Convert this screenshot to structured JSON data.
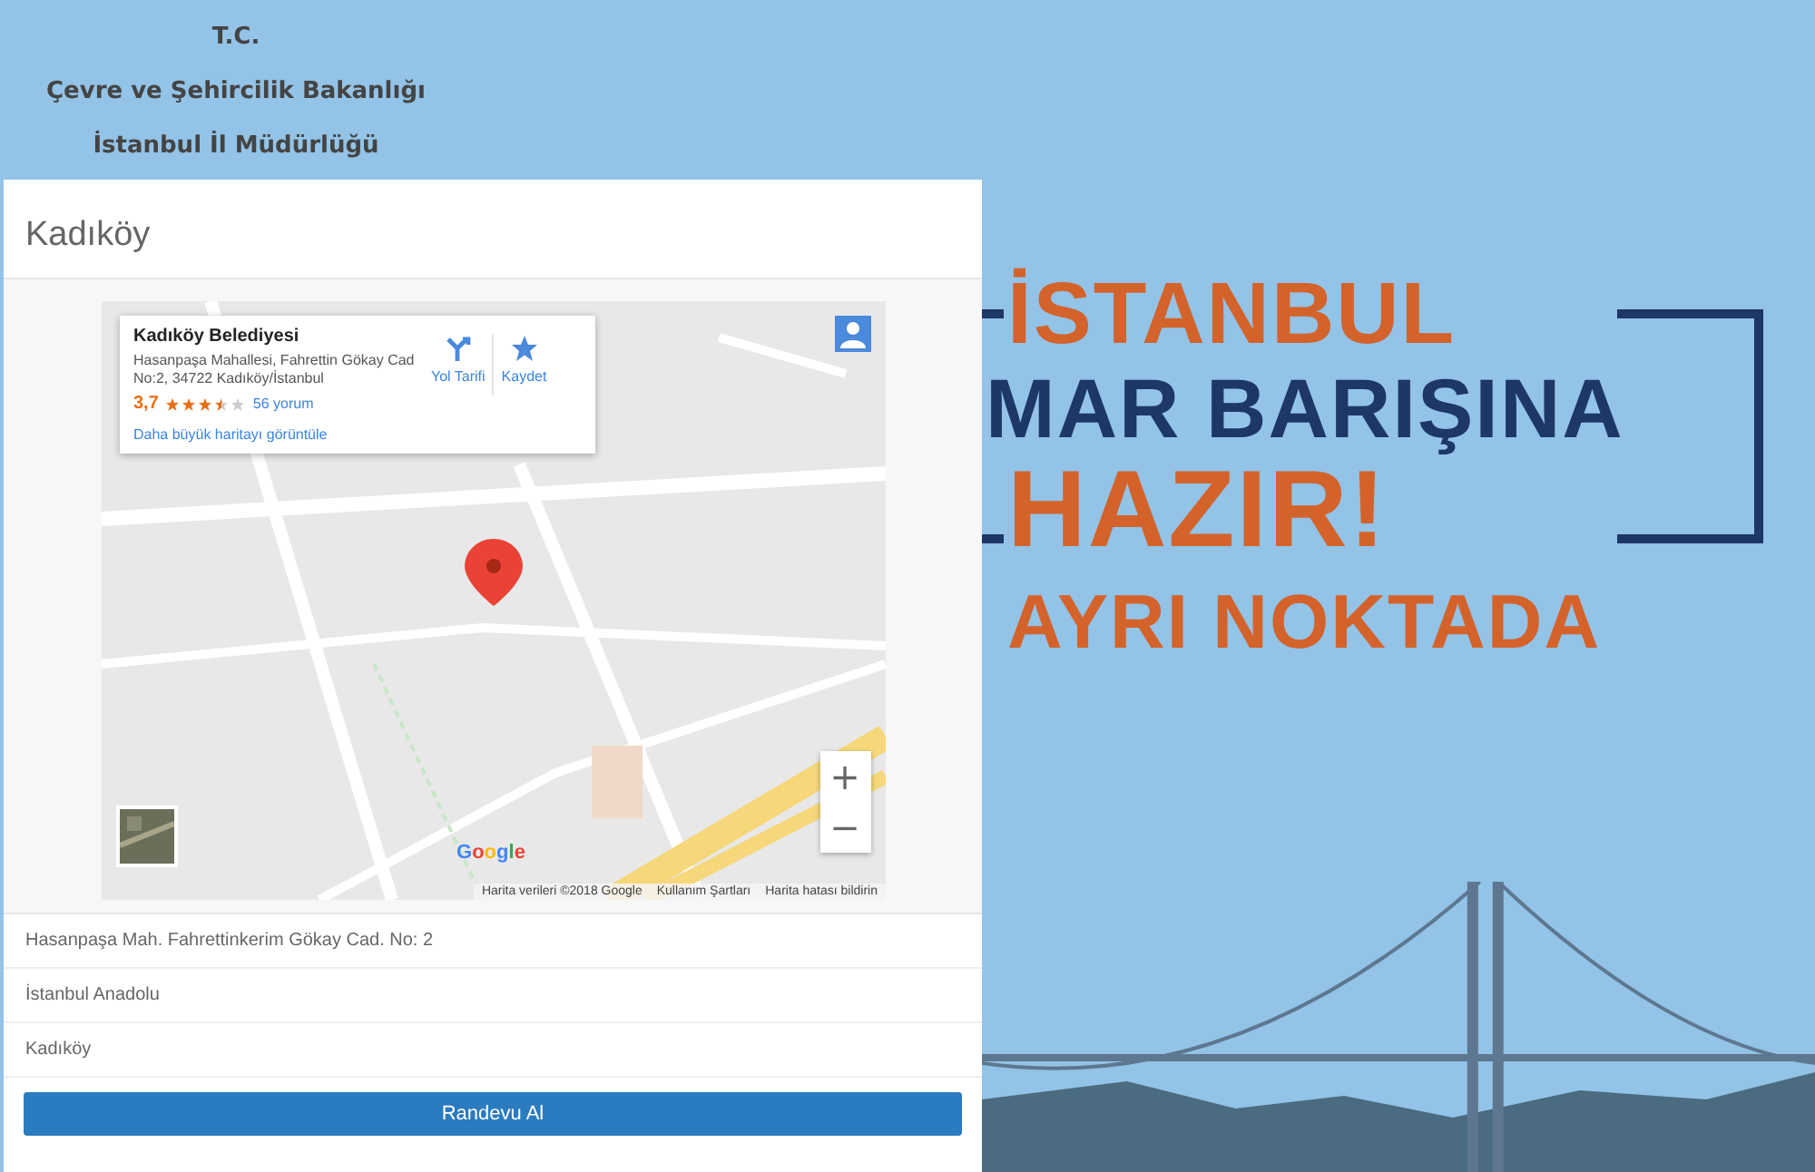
{
  "header": {
    "lines": [
      "T.C.",
      "Çevre ve Şehircilik Bakanlığı",
      "İstanbul İl Müdürlüğü"
    ]
  },
  "card": {
    "title": "Kadıköy",
    "map": {
      "info": {
        "name": "Kadıköy Belediyesi",
        "address": "Hasanpaşa Mahallesi, Fahrettin Gökay Cad No:2, 34722 Kadıköy/İstanbul",
        "rating": "3,7",
        "stars": 3.5,
        "reviews": "56 yorum",
        "larger_map": "Daha büyük haritayı görüntüle",
        "directions": "Yol Tarifi",
        "save": "Kaydet"
      },
      "zoom_in": "+",
      "zoom_out": "−",
      "logo": "Google",
      "attribution": [
        "Harita verileri ©2018 Google",
        "Kullanım Şartları",
        "Harita hatası bildirin"
      ]
    },
    "details": [
      "Hasanpaşa Mah. Fahrettinkerim Gökay Cad. No: 2",
      "İstanbul Anadolu",
      "Kadıköy"
    ],
    "button": "Randevu Al"
  },
  "banner": {
    "lines": [
      {
        "text": "İSTANBUL",
        "kind": "accent"
      },
      {
        "text": "MAR BARIŞINA",
        "kind": "main"
      },
      {
        "text": "HAZIR!",
        "kind": "accent"
      },
      {
        "text": "AYRI NOKTADA",
        "kind": "accent"
      }
    ]
  }
}
